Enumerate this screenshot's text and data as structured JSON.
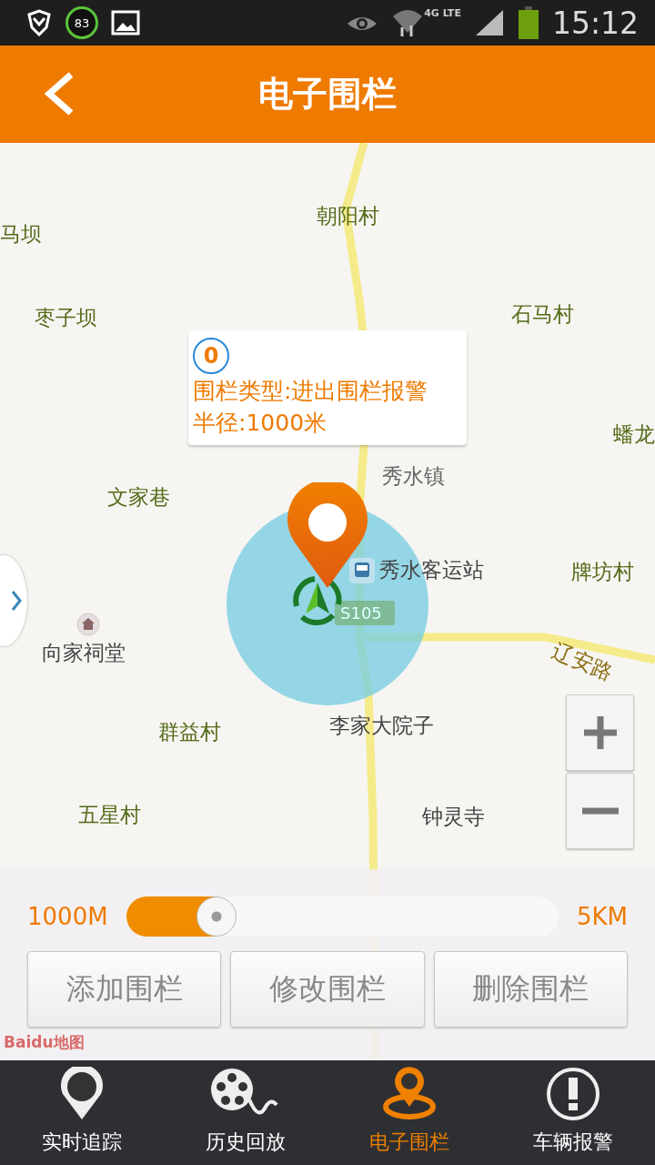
{
  "status_bar": {
    "notification_badge": "83",
    "network": "4G LTE",
    "time": "15:12"
  },
  "header": {
    "title": "电子围栏"
  },
  "map": {
    "labels": [
      {
        "text": "马坝"
      },
      {
        "text": "朝阳村"
      },
      {
        "text": "枣子坝"
      },
      {
        "text": "石马村"
      },
      {
        "text": "蟠龙"
      },
      {
        "text": "秀水镇"
      },
      {
        "text": "文家巷"
      },
      {
        "text": "秀水客运站"
      },
      {
        "text": "牌坊村"
      },
      {
        "text": "向家祠堂"
      },
      {
        "text": "辽安路"
      },
      {
        "text": "群益村"
      },
      {
        "text": "李家大院子"
      },
      {
        "text": "五星村"
      },
      {
        "text": "钟灵寺"
      }
    ],
    "road_shield": "S105",
    "logo": "Baidu地图",
    "callout": {
      "index": "0",
      "type_line": "围栏类型:进出围栏报警",
      "radius_line": "半径:1000米"
    }
  },
  "radius_slider": {
    "min_label": "1000M",
    "max_label": "5KM",
    "level": 0.21
  },
  "actions": [
    "添加围栏",
    "修改围栏",
    "删除围栏"
  ],
  "tabs": [
    {
      "label": "实时追踪",
      "selected": false
    },
    {
      "label": "历史回放",
      "selected": false
    },
    {
      "label": "电子围栏",
      "selected": true
    },
    {
      "label": "车辆报警",
      "selected": false
    }
  ]
}
